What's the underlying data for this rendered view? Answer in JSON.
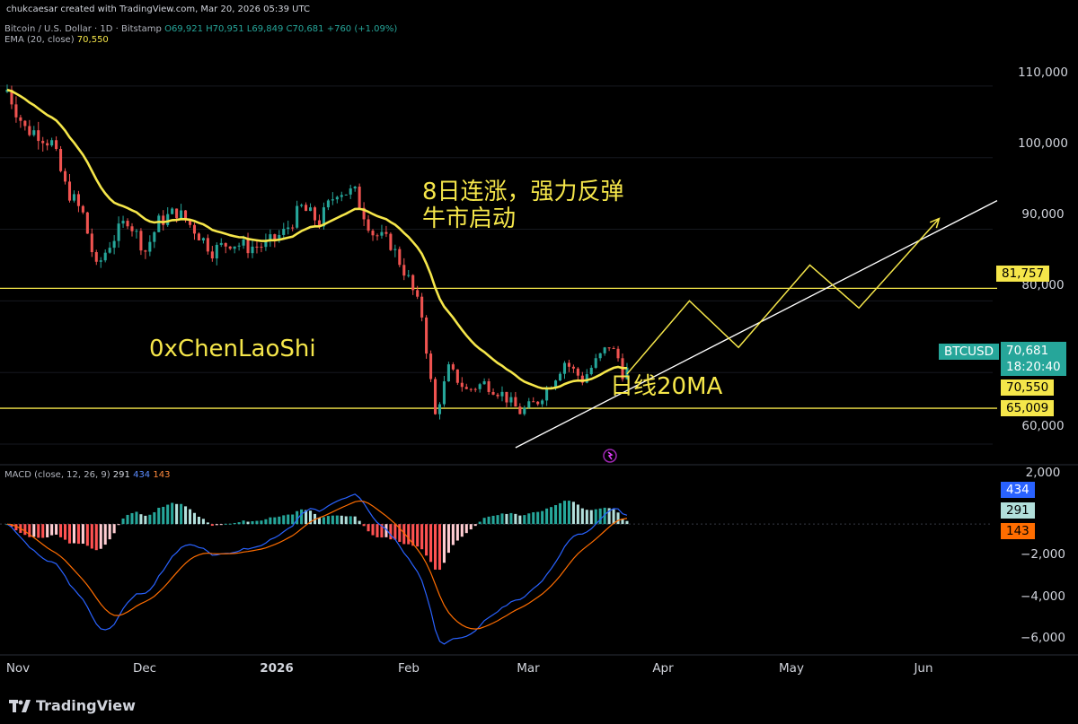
{
  "header": {
    "credit": "chukcaesar created with TradingView.com, Mar 20, 2026 05:39 UTC",
    "symbol": "Bitcoin / U.S. Dollar · 1D · Bitstamp",
    "ohlc": "O69,921  H70,951  L69,849  C70,681  +760 (+1.09%)",
    "ema_label": "EMA (20, close)",
    "ema_value": "70,550",
    "macd_label": "MACD (close, 12, 26, 9)",
    "macd_v1": "291",
    "macd_v2": "434",
    "macd_v3": "143"
  },
  "price_axis": [
    "110,000",
    "100,000",
    "90,000",
    "80,000",
    "60,000"
  ],
  "macd_axis": [
    "2,000",
    "−2,000",
    "−4,000",
    "−6,000"
  ],
  "time_axis": [
    "Nov",
    "Dec",
    "2026",
    "Feb",
    "Mar",
    "Apr",
    "May",
    "Jun"
  ],
  "tags": {
    "level_high": "81,757",
    "symbol": "BTCUSD",
    "last_price": "70,681",
    "countdown": "18:20:40",
    "ema": "70,550",
    "level_low": "65,009",
    "macd_hist": "434",
    "macd_line": "291",
    "macd_signal": "143"
  },
  "annotations": {
    "headline1": "8日连涨，强力反弹",
    "headline2": "牛市启动",
    "watermark": "0xChenLaoShi",
    "ma_label": "日线20MA"
  },
  "branding": "TradingView",
  "colors": {
    "up": "#26a69a",
    "down": "#ef5350",
    "ema": "#f5e64a",
    "macd": "#2962ff",
    "signal": "#ff6d00",
    "trendline": "#ffffff",
    "annotation": "#f5e64a"
  },
  "chart_data": [
    {
      "type": "candlestick",
      "title": "Bitcoin / U.S. Dollar · 1D · Bitstamp",
      "ylim": [
        57500,
        117000
      ],
      "x_range": [
        "2025-11-01",
        "2026-06-10"
      ],
      "close_series": [
        [
          "2025-11-01",
          109500
        ],
        [
          "2025-11-05",
          104000
        ],
        [
          "2025-11-08",
          103500
        ],
        [
          "2025-11-11",
          102000
        ],
        [
          "2025-11-14",
          96000
        ],
        [
          "2025-11-18",
          92000
        ],
        [
          "2025-11-21",
          84500
        ],
        [
          "2025-11-24",
          88000
        ],
        [
          "2025-11-28",
          91500
        ],
        [
          "2025-12-02",
          87000
        ],
        [
          "2025-12-05",
          91000
        ],
        [
          "2025-12-09",
          92500
        ],
        [
          "2025-12-13",
          90000
        ],
        [
          "2025-12-17",
          87000
        ],
        [
          "2025-12-21",
          88200
        ],
        [
          "2025-12-25",
          87500
        ],
        [
          "2025-12-29",
          87800
        ],
        [
          "2026-01-02",
          89500
        ],
        [
          "2026-01-06",
          93000
        ],
        [
          "2026-01-10",
          91000
        ],
        [
          "2026-01-14",
          95500
        ],
        [
          "2026-01-18",
          95000
        ],
        [
          "2026-01-22",
          89500
        ],
        [
          "2026-01-26",
          88000
        ],
        [
          "2026-01-30",
          83000
        ],
        [
          "2026-02-02",
          78000
        ],
        [
          "2026-02-05",
          64000
        ],
        [
          "2026-02-08",
          70500
        ],
        [
          "2026-02-12",
          67500
        ],
        [
          "2026-02-16",
          68500
        ],
        [
          "2026-02-20",
          67000
        ],
        [
          "2026-02-24",
          64500
        ],
        [
          "2026-02-28",
          66000
        ],
        [
          "2026-03-03",
          68500
        ],
        [
          "2026-03-06",
          71500
        ],
        [
          "2026-03-10",
          69000
        ],
        [
          "2026-03-13",
          71500
        ],
        [
          "2026-03-16",
          73800
        ],
        [
          "2026-03-18",
          72000
        ],
        [
          "2026-03-19",
          69921
        ],
        [
          "2026-03-20",
          70681
        ]
      ],
      "ema20": {
        "label": "EMA (20, close)",
        "last": 70550
      },
      "horizontal_lines": [
        81757,
        65009
      ]
    },
    {
      "type": "macd",
      "title": "MACD (close, 12, 26, 9)",
      "ylim": [
        -6500,
        2500
      ],
      "last": {
        "histogram": 291,
        "macd": 434,
        "signal": 143
      }
    }
  ]
}
